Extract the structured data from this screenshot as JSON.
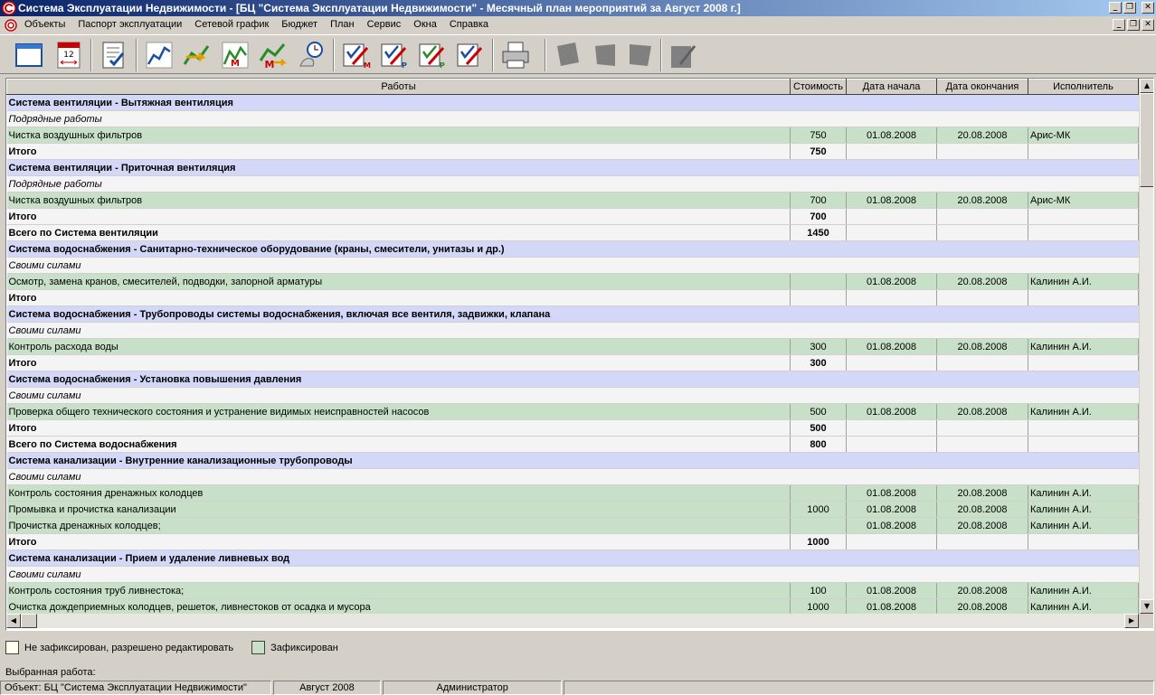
{
  "window": {
    "title": "Система Эксплуатации Недвижимости - [БЦ \"Система Эксплуатации Недвижимости\" - Месячный план мероприятий за Август 2008 г.]",
    "controls": [
      "_",
      "❐",
      "✕"
    ]
  },
  "menu": {
    "items": [
      "Объекты",
      "Паспорт эксплуатации",
      "Сетевой график",
      "Бюджет",
      "План",
      "Сервис",
      "Окна",
      "Справка"
    ]
  },
  "toolbar": {
    "buttons": [
      {
        "icon": "window-icon"
      },
      {
        "icon": "calendar-icon"
      },
      {
        "icon": "checklist-icon"
      },
      {
        "icon": "chart-icon"
      },
      {
        "icon": "chart-arrow-icon"
      },
      {
        "icon": "chart-m-icon"
      },
      {
        "icon": "chart-m-arrow-icon"
      },
      {
        "icon": "clock-scroll-icon"
      },
      {
        "icon": "edit-m-icon"
      },
      {
        "icon": "edit-p-icon"
      },
      {
        "icon": "edit-r-icon"
      },
      {
        "icon": "edit-check-icon"
      },
      {
        "icon": "print-icon"
      },
      {
        "icon": "disabled-doc-icon"
      },
      {
        "icon": "disabled-doc2-icon"
      },
      {
        "icon": "disabled-doc3-icon"
      },
      {
        "icon": "disabled-edit-icon"
      }
    ]
  },
  "grid": {
    "columns": [
      "Работы",
      "Стоимость",
      "Дата начала",
      "Дата окончания",
      "Исполнитель"
    ],
    "rows": [
      {
        "type": "header",
        "name": "Система вентиляции - Вытяжная вентиляция"
      },
      {
        "type": "sub",
        "name": "Подрядные работы"
      },
      {
        "type": "work",
        "name": "Чистка воздушных фильтров",
        "cost": "750",
        "start": "01.08.2008",
        "end": "20.08.2008",
        "executor": "Арис-МК"
      },
      {
        "type": "total",
        "name": "Итого",
        "cost": "750"
      },
      {
        "type": "header",
        "name": "Система вентиляции - Приточная вентиляция"
      },
      {
        "type": "sub",
        "name": "Подрядные работы"
      },
      {
        "type": "work",
        "name": "Чистка воздушных фильтров",
        "cost": "700",
        "start": "01.08.2008",
        "end": "20.08.2008",
        "executor": "Арис-МК"
      },
      {
        "type": "total",
        "name": "Итого",
        "cost": "700"
      },
      {
        "type": "grand",
        "name": "Всего по Система вентиляции",
        "cost": "1450"
      },
      {
        "type": "header",
        "name": "Система водоснабжения - Санитарно-техническое оборудование (краны, смесители, унитазы и др.)"
      },
      {
        "type": "sub",
        "name": "Своими силами"
      },
      {
        "type": "work",
        "name": "Осмотр, замена кранов, смесителей, подводки, запорной арматуры",
        "cost": "",
        "start": "01.08.2008",
        "end": "20.08.2008",
        "executor": "Калинин А.И."
      },
      {
        "type": "total",
        "name": "Итого",
        "cost": ""
      },
      {
        "type": "header",
        "name": "Система водоснабжения - Трубопроводы системы  водоснабжения, включая все вентиля, задвижки, клапана"
      },
      {
        "type": "sub",
        "name": "Своими силами"
      },
      {
        "type": "work",
        "name": "Контроль расхода воды",
        "cost": "300",
        "start": "01.08.2008",
        "end": "20.08.2008",
        "executor": "Калинин А.И."
      },
      {
        "type": "total",
        "name": "Итого",
        "cost": "300"
      },
      {
        "type": "header",
        "name": "Система водоснабжения - Установка повышения давления"
      },
      {
        "type": "sub",
        "name": "Своими силами"
      },
      {
        "type": "work",
        "name": "Проверка общего технического состояния и устранение видимых неисправностей насосов",
        "cost": "500",
        "start": "01.08.2008",
        "end": "20.08.2008",
        "executor": "Калинин А.И."
      },
      {
        "type": "total",
        "name": "Итого",
        "cost": "500"
      },
      {
        "type": "grand",
        "name": "Всего по Система водоснабжения",
        "cost": "800"
      },
      {
        "type": "header",
        "name": "Система канализации - Внутренние канализационные трубопроводы"
      },
      {
        "type": "sub",
        "name": "Своими силами"
      },
      {
        "type": "work",
        "name": "Контроль состояния дренажных колодцев",
        "cost": "",
        "start": "01.08.2008",
        "end": "20.08.2008",
        "executor": "Калинин А.И."
      },
      {
        "type": "work",
        "name": "Промывка и прочистка канализации",
        "cost": "1000",
        "start": "01.08.2008",
        "end": "20.08.2008",
        "executor": "Калинин А.И."
      },
      {
        "type": "work",
        "name": "Прочистка дренажных колодцев;",
        "cost": "",
        "start": "01.08.2008",
        "end": "20.08.2008",
        "executor": "Калинин А.И."
      },
      {
        "type": "total",
        "name": "Итого",
        "cost": "1000"
      },
      {
        "type": "header",
        "name": "Система канализации - Прием и удаление ливневых вод"
      },
      {
        "type": "sub",
        "name": "Своими силами"
      },
      {
        "type": "work",
        "name": "Контроль состояния труб ливнестока;",
        "cost": "100",
        "start": "01.08.2008",
        "end": "20.08.2008",
        "executor": "Калинин А.И."
      },
      {
        "type": "work",
        "name": "Очистка дождеприемных колодцев, решеток, ливнестоков от осадка и мусора",
        "cost": "1000",
        "start": "01.08.2008",
        "end": "20.08.2008",
        "executor": "Калинин А.И."
      }
    ]
  },
  "legend": {
    "items": [
      {
        "label": "Не зафиксирован, разрешено редактировать",
        "color": "#fffff0"
      },
      {
        "label": "Зафиксирован",
        "color": "#c8e0c8"
      }
    ]
  },
  "selected_work_label": "Выбранная работа:",
  "status": {
    "object": "Объект: БЦ \"Система Эксплуатации Недвижимости\"",
    "period": "Август 2008",
    "user": "Администратор"
  }
}
